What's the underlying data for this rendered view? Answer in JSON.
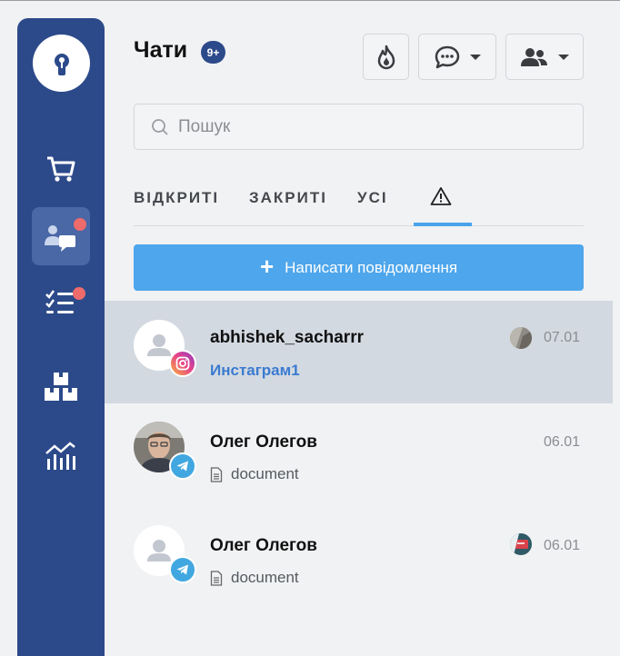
{
  "header": {
    "title": "Чати",
    "unread_badge": "9+"
  },
  "search": {
    "placeholder": "Пошук",
    "value": ""
  },
  "tabs": [
    {
      "label": "ВІДКРИТІ"
    },
    {
      "label": "ЗАКРИТІ"
    },
    {
      "label": "УСІ"
    }
  ],
  "compose": {
    "label": "Написати повідомлення"
  },
  "chats": [
    {
      "name": "abhishek_sacharrr",
      "subtitle": "Инстаграм1",
      "date": "07.01",
      "channel": "instagram"
    },
    {
      "name": "Олег Олегов",
      "subtitle": "document",
      "date": "06.01",
      "channel": "telegram"
    },
    {
      "name": "Олег Олегов",
      "subtitle": "document",
      "date": "06.01",
      "channel": "telegram"
    }
  ],
  "colors": {
    "sidebar": "#2c4a8a",
    "accent": "#4ea6ec",
    "selected_row": "#d3d9e1",
    "notification_dot": "#ee6b6b"
  },
  "icons": [
    "keyhole-logo-icon",
    "cart-icon",
    "chats-icon",
    "tasks-icon",
    "boxes-icon",
    "analytics-icon",
    "fire-icon",
    "chat-bubble-icon",
    "users-icon",
    "search-icon",
    "warning-icon",
    "instagram-icon",
    "telegram-icon",
    "document-icon"
  ]
}
